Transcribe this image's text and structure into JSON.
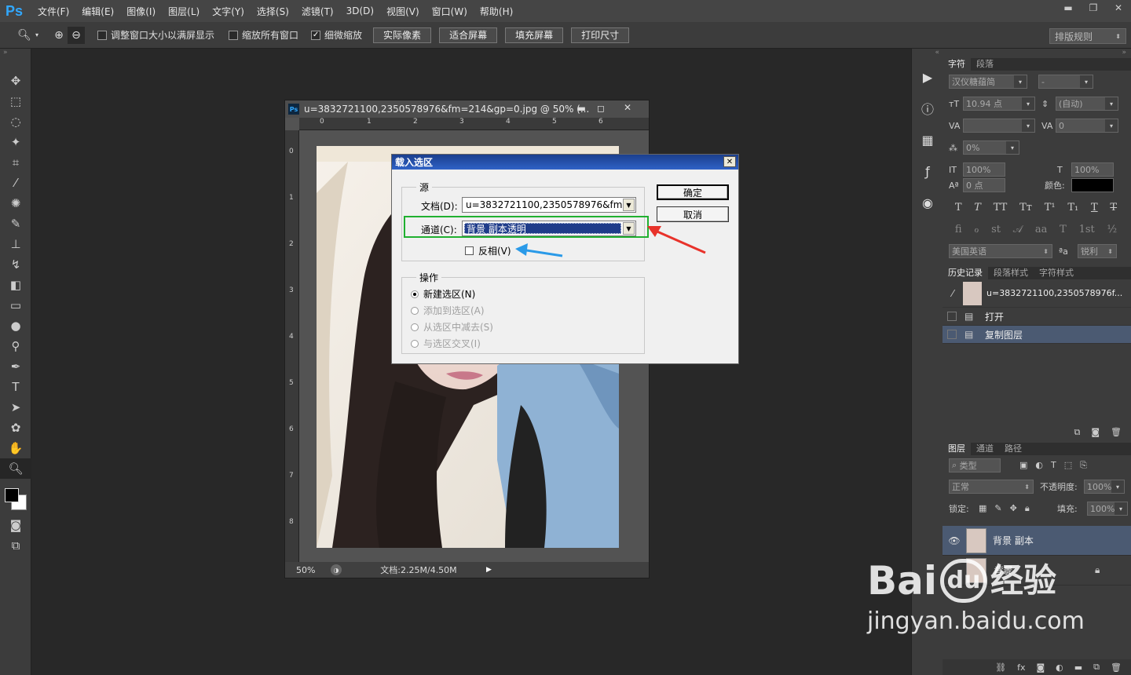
{
  "app": {
    "logo": "Ps"
  },
  "menu": [
    "文件(F)",
    "编辑(E)",
    "图像(I)",
    "图层(L)",
    "文字(Y)",
    "选择(S)",
    "滤镜(T)",
    "3D(D)",
    "视图(V)",
    "窗口(W)",
    "帮助(H)"
  ],
  "options": {
    "check_resize": "调整窗口大小以满屏显示",
    "check_zoom_all": "缩放所有窗口",
    "check_scrubby": "细微缩放",
    "btn_actual": "实际像素",
    "btn_fit": "适合屏幕",
    "btn_fill": "填充屏幕",
    "btn_print": "打印尺寸",
    "layout": "排版规则"
  },
  "document": {
    "title": "u=3832721100,2350578976&fm=214&gp=0.jpg @ 50% (...",
    "zoom": "50%",
    "status": "文档:2.25M/4.50M",
    "ruler_top": [
      "0",
      "1",
      "2",
      "3",
      "4",
      "5",
      "6"
    ],
    "ruler_left": [
      "0",
      "1",
      "2",
      "3",
      "4",
      "5",
      "6",
      "7",
      "8"
    ]
  },
  "dialog": {
    "title": "载入选区",
    "source_label": "源",
    "doc_label": "文档(D):",
    "doc_value": "u=3832721100,2350578976&fm...",
    "channel_label": "通道(C):",
    "channel_value": "背景 副本透明",
    "invert_label": "反相(V)",
    "ok": "确定",
    "cancel": "取消",
    "op_label": "操作",
    "ops": [
      "新建选区(N)",
      "添加到选区(A)",
      "从选区中减去(S)",
      "与选区交叉(I)"
    ]
  },
  "char_panel": {
    "tabs": [
      "字符",
      "段落"
    ],
    "font": "汉仪糖蕴简",
    "style": "-",
    "size": "10.94 点",
    "leading": "(自动)",
    "tracking": "0",
    "scale_pct": "0%",
    "vscale": "100%",
    "hscale": "100%",
    "baseline": "0 点",
    "color_label": "颜色:",
    "lang": "美国英语",
    "aa_mark": "ªa",
    "aa": "锐利"
  },
  "history_panel": {
    "tabs": [
      "历史记录",
      "段落样式",
      "字符样式"
    ],
    "snapshot": "u=3832721100,2350578976f...",
    "items": [
      "打开",
      "复制图层"
    ]
  },
  "layers_panel": {
    "tabs": [
      "图层",
      "通道",
      "路径"
    ],
    "filter": "类型",
    "blend": "正常",
    "opacity_label": "不透明度:",
    "opacity": "100%",
    "lock_label": "锁定:",
    "fill_label": "填充:",
    "fill": "100%",
    "layers": [
      "背景 副本",
      "背景"
    ]
  },
  "watermark": {
    "brand": "Bai",
    "du": "du",
    "cn": "经验",
    "url": "jingyan.baidu.com"
  },
  "colors": {
    "accent": "#31a8ff",
    "selection": "#4b5a72",
    "green_box": "#20b030",
    "red_arrow": "#e8322a",
    "blue_arrow": "#2a9ae8"
  }
}
